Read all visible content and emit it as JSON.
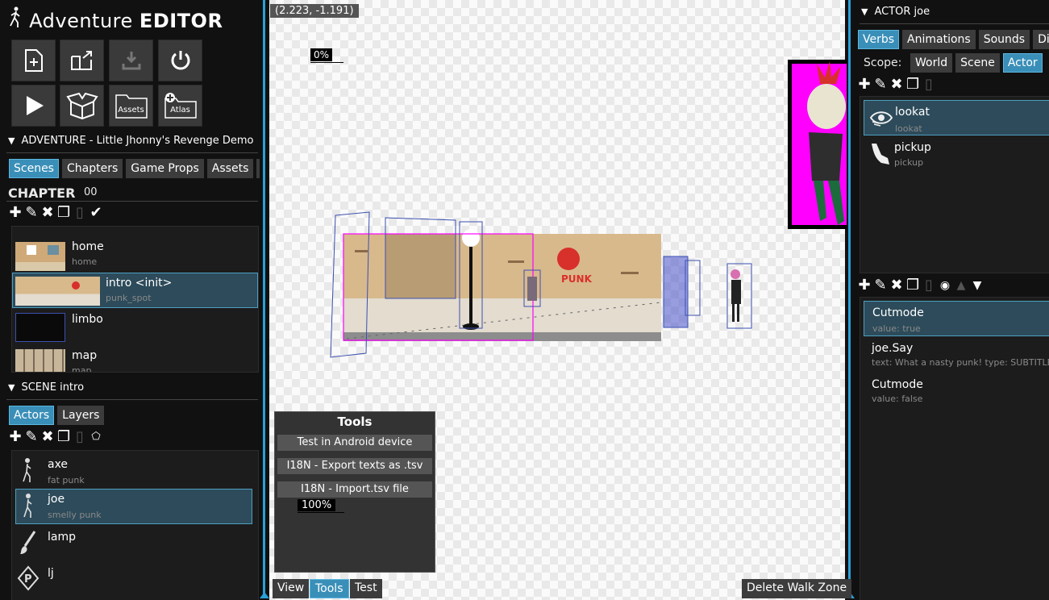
{
  "app": {
    "title_regular": "Adventure",
    "title_bold": "EDITOR"
  },
  "toolbar": {
    "new_project": "new-project",
    "open_project": "open-project",
    "save_project": "save-project",
    "exit": "exit",
    "play": "play",
    "package": "package",
    "assets_label": "Assets",
    "atlas_label": "Atlas"
  },
  "adventure": {
    "header": "ADVENTURE - Little Jhonny's Revenge Demo",
    "tabs": [
      "Scenes",
      "Chapters",
      "Game Props",
      "Assets",
      "Re"
    ],
    "chapter_label": "CHAPTER",
    "chapter_value": "00",
    "scenes": [
      {
        "name": "home",
        "id": "home"
      },
      {
        "name": "intro <init>",
        "id": "punk_spot"
      },
      {
        "name": "limbo",
        "id": ""
      },
      {
        "name": "map",
        "id": "map"
      }
    ]
  },
  "scene": {
    "header": "SCENE intro",
    "tabs": [
      "Actors",
      "Layers"
    ],
    "actors": [
      {
        "name": "axe",
        "desc": "fat punk"
      },
      {
        "name": "joe",
        "desc": "smelly punk"
      },
      {
        "name": "lamp",
        "desc": ""
      },
      {
        "name": "lj",
        "desc": ""
      }
    ]
  },
  "canvas": {
    "coordinates": "(2.223, -1.191)",
    "progress_top": "0%",
    "progress_tools": "100%",
    "progress_top_value": 0,
    "progress_tools_value": 100,
    "graffiti": "PUNK",
    "tools_title": "Tools",
    "tools_buttons": [
      "Test in Android device",
      "I18N - Export texts as .tsv",
      "I18N - Import.tsv file"
    ],
    "bottom_buttons": [
      "View",
      "Tools",
      "Test"
    ],
    "delete_walk_zone": "Delete Walk Zone"
  },
  "actor": {
    "header": "ACTOR joe",
    "tabs": [
      "Verbs",
      "Animations",
      "Sounds",
      "Dialo"
    ],
    "scope_label": "Scope:",
    "scope_options": [
      "World",
      "Scene",
      "Actor"
    ],
    "verbs": [
      {
        "name": "lookat",
        "id": "lookat"
      },
      {
        "name": "pickup",
        "id": "pickup"
      }
    ],
    "actions": [
      {
        "name": "Cutmode",
        "detail": "value: true"
      },
      {
        "name": "joe.Say",
        "detail": "text: What a nasty punk! type: SUBTITLE"
      },
      {
        "name": "Cutmode",
        "detail": "value: false"
      }
    ]
  },
  "colors": {
    "accent": "#3a8fb8",
    "selection": "#2d4b5a",
    "magenta": "#ff00ff",
    "canvas_line": "#2aa0d8"
  }
}
